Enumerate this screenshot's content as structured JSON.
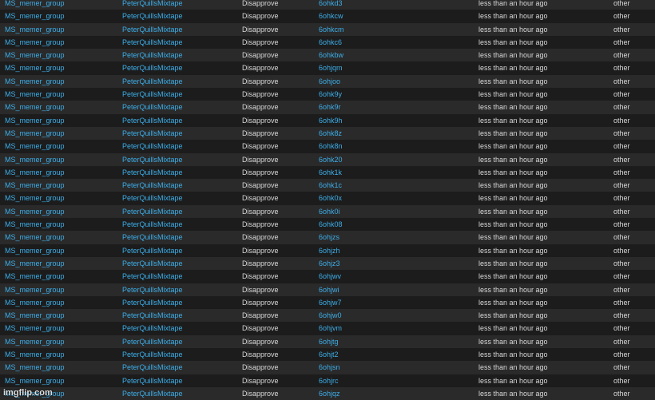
{
  "colors": {
    "link": "#3daee9",
    "text": "#d8d8d8",
    "row_odd": "#2a2a2a",
    "row_even": "#1c1c1c"
  },
  "rows": [
    {
      "group": "MS_memer_group",
      "user": "PeterQuillsMixtape",
      "action": "Disapprove",
      "id": "6ohkd3",
      "time": "less than an hour ago",
      "type": "other"
    },
    {
      "group": "MS_memer_group",
      "user": "PeterQuillsMixtape",
      "action": "Disapprove",
      "id": "6ohkcw",
      "time": "less than an hour ago",
      "type": "other"
    },
    {
      "group": "MS_memer_group",
      "user": "PeterQuillsMixtape",
      "action": "Disapprove",
      "id": "6ohkcm",
      "time": "less than an hour ago",
      "type": "other"
    },
    {
      "group": "MS_memer_group",
      "user": "PeterQuillsMixtape",
      "action": "Disapprove",
      "id": "6ohkc6",
      "time": "less than an hour ago",
      "type": "other"
    },
    {
      "group": "MS_memer_group",
      "user": "PeterQuillsMixtape",
      "action": "Disapprove",
      "id": "6ohkbw",
      "time": "less than an hour ago",
      "type": "other"
    },
    {
      "group": "MS_memer_group",
      "user": "PeterQuillsMixtape",
      "action": "Disapprove",
      "id": "6ohjqm",
      "time": "less than an hour ago",
      "type": "other"
    },
    {
      "group": "MS_memer_group",
      "user": "PeterQuillsMixtape",
      "action": "Disapprove",
      "id": "6ohjoo",
      "time": "less than an hour ago",
      "type": "other"
    },
    {
      "group": "MS_memer_group",
      "user": "PeterQuillsMixtape",
      "action": "Disapprove",
      "id": "6ohk9y",
      "time": "less than an hour ago",
      "type": "other"
    },
    {
      "group": "MS_memer_group",
      "user": "PeterQuillsMixtape",
      "action": "Disapprove",
      "id": "6ohk9r",
      "time": "less than an hour ago",
      "type": "other"
    },
    {
      "group": "MS_memer_group",
      "user": "PeterQuillsMixtape",
      "action": "Disapprove",
      "id": "6ohk9h",
      "time": "less than an hour ago",
      "type": "other"
    },
    {
      "group": "MS_memer_group",
      "user": "PeterQuillsMixtape",
      "action": "Disapprove",
      "id": "6ohk8z",
      "time": "less than an hour ago",
      "type": "other"
    },
    {
      "group": "MS_memer_group",
      "user": "PeterQuillsMixtape",
      "action": "Disapprove",
      "id": "6ohk8n",
      "time": "less than an hour ago",
      "type": "other"
    },
    {
      "group": "MS_memer_group",
      "user": "PeterQuillsMixtape",
      "action": "Disapprove",
      "id": "6ohk20",
      "time": "less than an hour ago",
      "type": "other"
    },
    {
      "group": "MS_memer_group",
      "user": "PeterQuillsMixtape",
      "action": "Disapprove",
      "id": "6ohk1k",
      "time": "less than an hour ago",
      "type": "other"
    },
    {
      "group": "MS_memer_group",
      "user": "PeterQuillsMixtape",
      "action": "Disapprove",
      "id": "6ohk1c",
      "time": "less than an hour ago",
      "type": "other"
    },
    {
      "group": "MS_memer_group",
      "user": "PeterQuillsMixtape",
      "action": "Disapprove",
      "id": "6ohk0x",
      "time": "less than an hour ago",
      "type": "other"
    },
    {
      "group": "MS_memer_group",
      "user": "PeterQuillsMixtape",
      "action": "Disapprove",
      "id": "6ohk0i",
      "time": "less than an hour ago",
      "type": "other"
    },
    {
      "group": "MS_memer_group",
      "user": "PeterQuillsMixtape",
      "action": "Disapprove",
      "id": "6ohk08",
      "time": "less than an hour ago",
      "type": "other"
    },
    {
      "group": "MS_memer_group",
      "user": "PeterQuillsMixtape",
      "action": "Disapprove",
      "id": "6ohjzs",
      "time": "less than an hour ago",
      "type": "other"
    },
    {
      "group": "MS_memer_group",
      "user": "PeterQuillsMixtape",
      "action": "Disapprove",
      "id": "6ohjzh",
      "time": "less than an hour ago",
      "type": "other"
    },
    {
      "group": "MS_memer_group",
      "user": "PeterQuillsMixtape",
      "action": "Disapprove",
      "id": "6ohjz3",
      "time": "less than an hour ago",
      "type": "other"
    },
    {
      "group": "MS_memer_group",
      "user": "PeterQuillsMixtape",
      "action": "Disapprove",
      "id": "6ohjwv",
      "time": "less than an hour ago",
      "type": "other"
    },
    {
      "group": "MS_memer_group",
      "user": "PeterQuillsMixtape",
      "action": "Disapprove",
      "id": "6ohjwi",
      "time": "less than an hour ago",
      "type": "other"
    },
    {
      "group": "MS_memer_group",
      "user": "PeterQuillsMixtape",
      "action": "Disapprove",
      "id": "6ohjw7",
      "time": "less than an hour ago",
      "type": "other"
    },
    {
      "group": "MS_memer_group",
      "user": "PeterQuillsMixtape",
      "action": "Disapprove",
      "id": "6ohjw0",
      "time": "less than an hour ago",
      "type": "other"
    },
    {
      "group": "MS_memer_group",
      "user": "PeterQuillsMixtape",
      "action": "Disapprove",
      "id": "6ohjvm",
      "time": "less than an hour ago",
      "type": "other"
    },
    {
      "group": "MS_memer_group",
      "user": "PeterQuillsMixtape",
      "action": "Disapprove",
      "id": "6ohjtg",
      "time": "less than an hour ago",
      "type": "other"
    },
    {
      "group": "MS_memer_group",
      "user": "PeterQuillsMixtape",
      "action": "Disapprove",
      "id": "6ohjt2",
      "time": "less than an hour ago",
      "type": "other"
    },
    {
      "group": "MS_memer_group",
      "user": "PeterQuillsMixtape",
      "action": "Disapprove",
      "id": "6ohjsn",
      "time": "less than an hour ago",
      "type": "other"
    },
    {
      "group": "MS_memer_group",
      "user": "PeterQuillsMixtape",
      "action": "Disapprove",
      "id": "6ohjrc",
      "time": "less than an hour ago",
      "type": "other"
    },
    {
      "group": "MS_memer_group",
      "user": "PeterQuillsMixtape",
      "action": "Disapprove",
      "id": "6ohjqz",
      "time": "less than an hour ago",
      "type": "other"
    }
  ],
  "watermark": "imgflip.com"
}
